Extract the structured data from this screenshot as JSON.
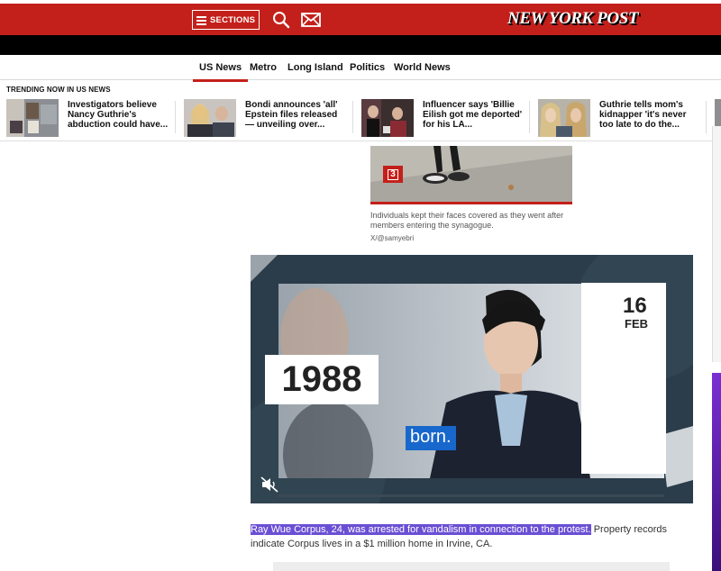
{
  "header": {
    "sections_label": "SECTIONS",
    "logo_text": "NEW YORK POST",
    "brand_color": "#c4201b"
  },
  "subnav": {
    "items": [
      {
        "label": "US News",
        "active": true
      },
      {
        "label": "Metro",
        "active": false
      },
      {
        "label": "Long Island",
        "active": false
      },
      {
        "label": "Politics",
        "active": false
      },
      {
        "label": "World News",
        "active": false
      }
    ]
  },
  "trending": {
    "label": "TRENDING NOW IN US NEWS",
    "items": [
      {
        "title": "Investigators believe Nancy Guthrie's abduction could have..."
      },
      {
        "title": "Bondi announces 'all' Epstein files released — unveiling over..."
      },
      {
        "title": "Influencer says 'Billie Eilish got me deported' for his LA..."
      },
      {
        "title": "Guthrie tells mom's kidnapper 'it's never too late to do the..."
      }
    ]
  },
  "article": {
    "gallery_count": "3",
    "photo_caption": "Individuals kept their faces covered as they went after members entering the synagogue.",
    "photo_credit": "X/@samyebri",
    "video": {
      "date_day": "16",
      "date_month": "FEB",
      "year": "1988",
      "subtitle": "born.",
      "muted": true
    },
    "paragraph_highlight": "Ray Wue Corpus, 24, was arrested for vandalism in connection to the protest.",
    "paragraph_rest": " Property records indicate Corpus lives in a $1 million home in Irvine, CA."
  }
}
